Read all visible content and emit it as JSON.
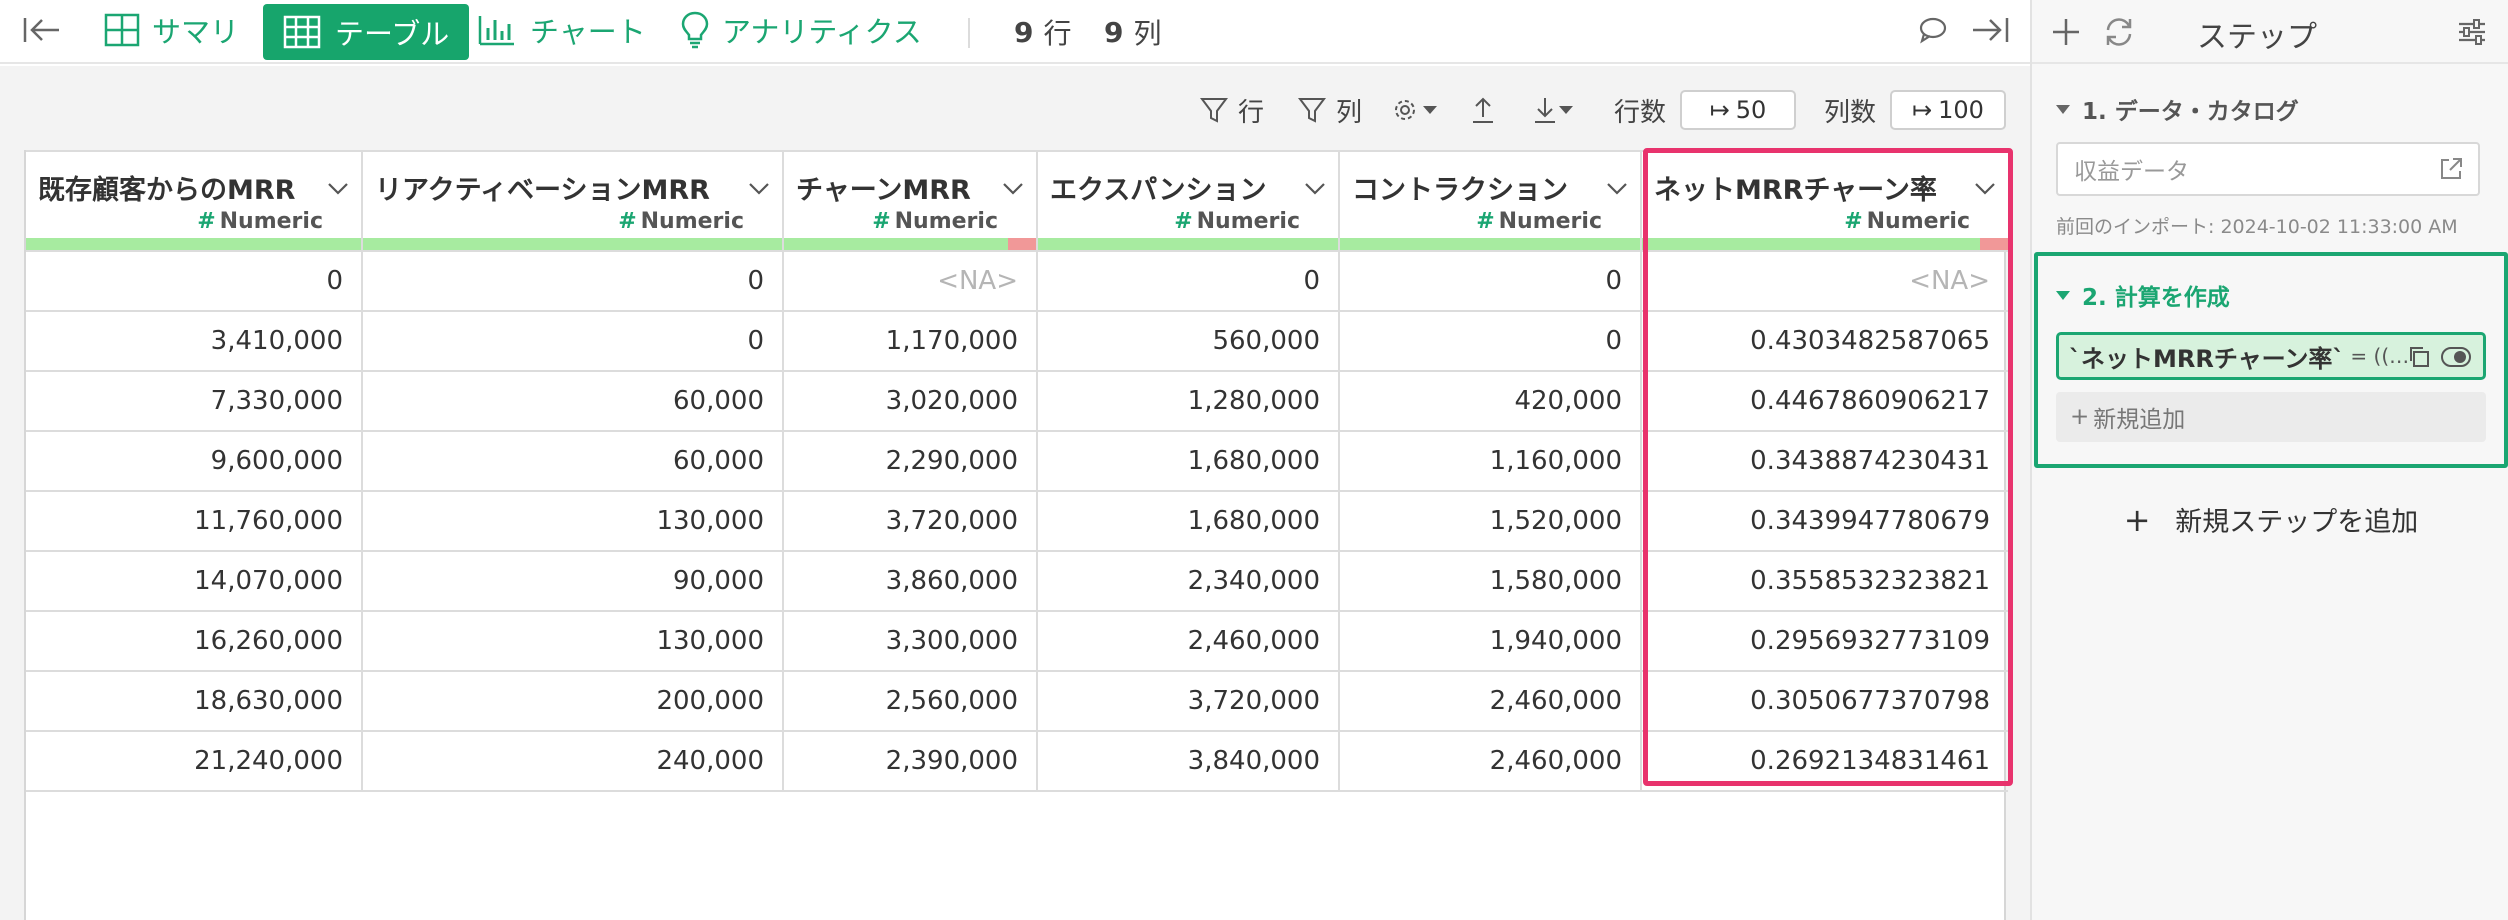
{
  "toolbar": {
    "tabs": [
      {
        "label": "サマリ",
        "icon": "summary-grid-icon"
      },
      {
        "label": "テーブル",
        "icon": "table-icon",
        "active": true
      },
      {
        "label": "チャート",
        "icon": "bar-chart-icon"
      },
      {
        "label": "アナリティクス",
        "icon": "lightbulb-icon"
      }
    ],
    "rows_count": "9",
    "rows_unit": "行",
    "cols_count": "9",
    "cols_unit": "列"
  },
  "table_tools": {
    "row_filter_label": "行",
    "col_filter_label": "列",
    "rows_label": "行数",
    "rows_value": "50",
    "cols_label": "列数",
    "cols_value": "100"
  },
  "table": {
    "columns": [
      {
        "name": "既存顧客からのMRR",
        "type": "Numeric"
      },
      {
        "name": "リアクティベーションMRR",
        "type": "Numeric"
      },
      {
        "name": "チャーンMRR",
        "type": "Numeric"
      },
      {
        "name": "エクスパンション",
        "type": "Numeric"
      },
      {
        "name": "コントラクション",
        "type": "Numeric"
      },
      {
        "name": "ネットMRRチャーン率",
        "type": "Numeric"
      }
    ],
    "rows": [
      [
        "0",
        "0",
        "<NA>",
        "0",
        "0",
        "<NA>"
      ],
      [
        "3,410,000",
        "0",
        "1,170,000",
        "560,000",
        "0",
        "0.4303482587065"
      ],
      [
        "7,330,000",
        "60,000",
        "3,020,000",
        "1,280,000",
        "420,000",
        "0.4467860906217"
      ],
      [
        "9,600,000",
        "60,000",
        "2,290,000",
        "1,680,000",
        "1,160,000",
        "0.3438874230431"
      ],
      [
        "11,760,000",
        "130,000",
        "3,720,000",
        "1,680,000",
        "1,520,000",
        "0.3439947780679"
      ],
      [
        "14,070,000",
        "90,000",
        "3,860,000",
        "2,340,000",
        "1,580,000",
        "0.3558532323821"
      ],
      [
        "16,260,000",
        "130,000",
        "3,300,000",
        "2,460,000",
        "1,940,000",
        "0.2956932773109"
      ],
      [
        "18,630,000",
        "200,000",
        "2,560,000",
        "3,720,000",
        "2,460,000",
        "0.3050677370798"
      ],
      [
        "21,240,000",
        "240,000",
        "2,390,000",
        "3,840,000",
        "2,460,000",
        "0.2692134831461"
      ]
    ]
  },
  "panel": {
    "title": "ステップ",
    "step1_title": "1. データ・カタログ",
    "catalog_value": "収益データ",
    "import_time": "前回のインポート: 2024-10-02 11:33:00 AM",
    "step2_title": "2. 計算を作成",
    "formula_name": "`ネットMRRチャーン率`",
    "formula_rest": "= ((…",
    "add_new_label": "新規追加",
    "add_step_label": "新規ステップを追加"
  },
  "colors": {
    "accent": "#1ba672",
    "active_tab_bg": "#17a56c",
    "highlight": "#e8336d",
    "quality_ok": "#a7eba0",
    "quality_bad": "#f19898"
  }
}
